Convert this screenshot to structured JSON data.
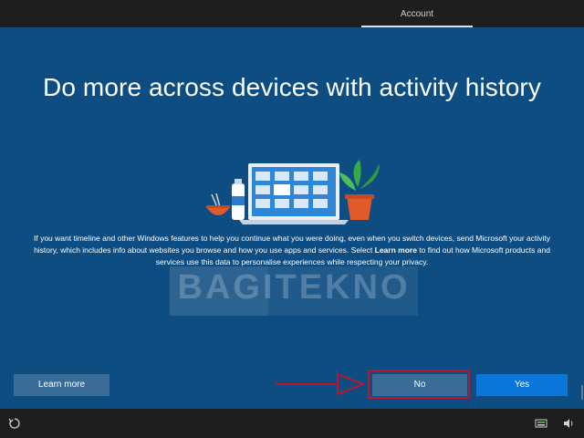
{
  "topbar": {
    "tab_label": "Account"
  },
  "main": {
    "title": "Do more across devices with activity history",
    "body_part1": "If you want timeline and other Windows features to help you continue what you were doing, even when you switch devices, send Microsoft your activity history, which includes info about websites you browse and how you use apps and services. Select ",
    "body_bold": "Learn more",
    "body_part2": " to find out how Microsoft products and services use this data to personalise experiences while respecting your privacy.",
    "watermark": "BAGITEKNO"
  },
  "buttons": {
    "learn_more": "Learn more",
    "no": "No",
    "yes": "Yes"
  },
  "bottombar": {
    "icons": [
      "ease-of-access-icon",
      "keyboard-icon",
      "volume-icon"
    ]
  },
  "colors": {
    "background": "#0d4d82",
    "accent": "#0a76d8",
    "secondary_button": "#3a6c98",
    "highlight": "#c0142a"
  }
}
